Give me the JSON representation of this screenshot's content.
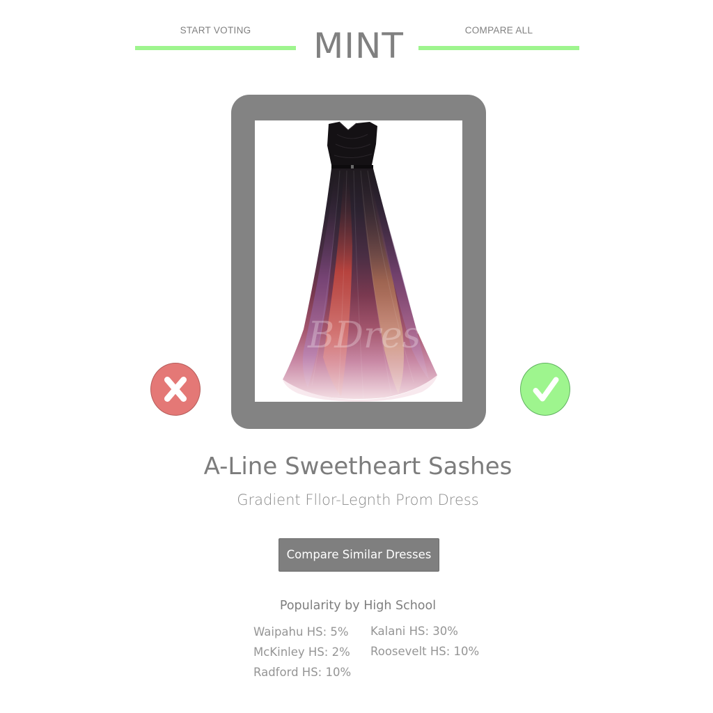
{
  "header": {
    "logo": "MINT",
    "nav_left": "START VOTING",
    "nav_right": "COMPARE ALL",
    "accent_color": "#9ef58e"
  },
  "photo": {
    "alt": "gradient prom dress",
    "watermark": "BDres"
  },
  "vote": {
    "reject_icon": "x-icon",
    "accept_icon": "checkmark-icon",
    "reject_color": "#e47876",
    "accept_color": "#9ef58e"
  },
  "dress": {
    "title": "A-Line Sweetheart Sashes",
    "subtitle": "Gradient Fllor-Legnth Prom Dress",
    "compare_label": "Compare Similar Dresses"
  },
  "popularity": {
    "heading": "Popularity by High School",
    "left": [
      "Waipahu HS: 5%",
      "McKinley HS: 2%",
      "Radford HS: 10%"
    ],
    "right": [
      "Kalani HS: 30%",
      "Roosevelt HS: 10%"
    ]
  }
}
